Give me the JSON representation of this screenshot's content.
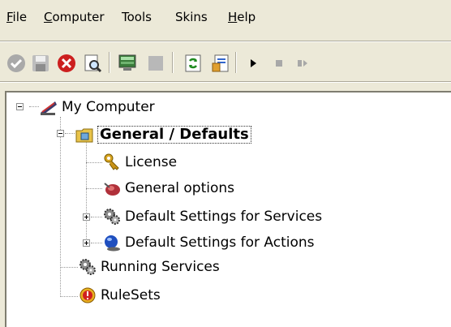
{
  "menubar": {
    "items": [
      {
        "label": "File",
        "mnemonic": "F",
        "rest": "ile"
      },
      {
        "label": "Computer",
        "mnemonic": "C",
        "rest": "omputer"
      },
      {
        "label": "Tools",
        "mnemonic": "",
        "rest": "Tools"
      },
      {
        "label": "Skins",
        "mnemonic": "",
        "rest": "Skins"
      },
      {
        "label": "Help",
        "mnemonic": "H",
        "rest": "elp"
      }
    ]
  },
  "toolbar": {
    "buttons": [
      "check-icon",
      "save-icon",
      "stop-circle-icon",
      "find-icon",
      "monitor-icon",
      "blank-square-icon",
      "refresh-icon",
      "settings-form-icon",
      "play-icon",
      "stop-icon",
      "pause-icon"
    ]
  },
  "tree": {
    "root": "My Computer",
    "general": "General / Defaults",
    "license": "License",
    "general_options": "General options",
    "default_services": "Default Settings for Services",
    "default_actions": "Default Settings for Actions",
    "running_services": "Running Services",
    "rulesets": "RuleSets"
  },
  "colors": {
    "chrome": "#ece9d8",
    "panel": "#ffffff",
    "stop_red": "#cc1f1f"
  }
}
